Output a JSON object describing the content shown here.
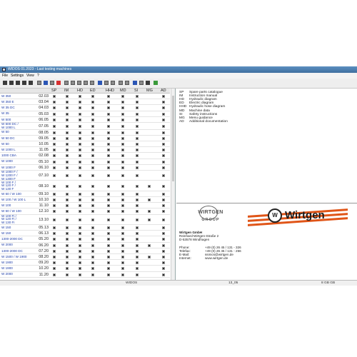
{
  "window": {
    "title": "WIDOS 01.2023 - Last testing machines"
  },
  "menu": [
    "File",
    "Settings",
    "View",
    "?"
  ],
  "grid": {
    "columns": [
      "SP",
      "IM",
      "HD",
      "ED",
      "HHD",
      "MD",
      "SI",
      "MG",
      "AD"
    ],
    "rows": [
      {
        "name": [
          "W 350"
        ],
        "code": "02.03",
        "cells": [
          1,
          1,
          1,
          1,
          1,
          1,
          1,
          0,
          1
        ]
      },
      {
        "name": [
          "W 350 E"
        ],
        "code": "03.04",
        "cells": [
          1,
          1,
          1,
          1,
          1,
          1,
          1,
          0,
          1
        ]
      },
      {
        "name": [
          "W 35 DC"
        ],
        "code": "04.03",
        "cells": [
          1,
          1,
          1,
          1,
          1,
          1,
          1,
          0,
          1
        ]
      },
      {
        "name": [
          "W 35"
        ],
        "code": "05.03",
        "cells": [
          1,
          1,
          1,
          1,
          1,
          1,
          1,
          0,
          1
        ]
      },
      {
        "name": [
          "W 500"
        ],
        "code": "06.05",
        "cells": [
          1,
          1,
          1,
          1,
          1,
          1,
          1,
          0,
          1
        ]
      },
      {
        "name": [
          "W 600 DC /",
          "W 1000 L"
        ],
        "code": "07.05",
        "cells": [
          1,
          1,
          1,
          1,
          1,
          1,
          1,
          0,
          1
        ]
      },
      {
        "name": [
          "W 50"
        ],
        "code": "08.05",
        "cells": [
          1,
          1,
          1,
          1,
          1,
          1,
          1,
          0,
          1
        ]
      },
      {
        "name": [
          "W 50 DC"
        ],
        "code": "09.05",
        "cells": [
          1,
          1,
          1,
          1,
          1,
          1,
          1,
          0,
          1
        ]
      },
      {
        "name": [
          "W 50"
        ],
        "code": "10.05",
        "cells": [
          1,
          1,
          1,
          1,
          1,
          1,
          1,
          0,
          1
        ]
      },
      {
        "name": [
          "W 1000 L"
        ],
        "code": "11.05",
        "cells": [
          1,
          1,
          1,
          1,
          1,
          1,
          1,
          0,
          1
        ]
      },
      {
        "name": [
          "1000 CBA"
        ],
        "code": "02.08",
        "cells": [
          1,
          1,
          1,
          1,
          1,
          1,
          1,
          0,
          1
        ]
      },
      {
        "name": [
          "W 1000"
        ],
        "code": "05.10",
        "cells": [
          1,
          1,
          1,
          1,
          1,
          1,
          1,
          0,
          1
        ]
      },
      {
        "name": [
          "W 1000 F"
        ],
        "code": "06.10",
        "cells": [
          1,
          1,
          1,
          1,
          1,
          1,
          1,
          0,
          1
        ]
      },
      {
        "name": [
          "W 1000 F /",
          "W 1200 F /",
          "W 1300 F"
        ],
        "code": "07.10",
        "cells": [
          1,
          1,
          1,
          1,
          1,
          1,
          1,
          0,
          1
        ]
      },
      {
        "name": [
          "W 100 F /",
          "W 120 F /",
          "W 130 F"
        ],
        "code": "08.10",
        "cells": [
          1,
          1,
          1,
          1,
          1,
          1,
          1,
          1,
          1
        ]
      },
      {
        "name": [
          "W 60 / W 100"
        ],
        "code": "09.10",
        "cells": [
          1,
          1,
          1,
          1,
          1,
          1,
          1,
          0,
          1
        ]
      },
      {
        "name": [
          "W 100 / W 100 L"
        ],
        "code": "10.10",
        "cells": [
          1,
          1,
          1,
          1,
          1,
          1,
          1,
          1,
          1
        ]
      },
      {
        "name": [
          "W 100"
        ],
        "code": "11.10",
        "cells": [
          1,
          1,
          1,
          1,
          1,
          1,
          1,
          0,
          1
        ]
      },
      {
        "name": [
          "W 60 / W 100"
        ],
        "code": "12.10",
        "cells": [
          1,
          1,
          1,
          1,
          1,
          1,
          1,
          1,
          1
        ]
      },
      {
        "name": [
          "W 100 Fi /",
          "W 120 Fi /",
          "W 130 Fi"
        ],
        "code": "13.10",
        "cells": [
          1,
          1,
          1,
          1,
          1,
          1,
          1,
          1,
          1
        ]
      },
      {
        "name": [
          "W 150"
        ],
        "code": "05.13",
        "cells": [
          1,
          1,
          1,
          1,
          1,
          1,
          1,
          0,
          1
        ]
      },
      {
        "name": [
          "W 150"
        ],
        "code": "06.13",
        "cells": [
          1,
          1,
          1,
          1,
          1,
          1,
          1,
          0,
          1
        ]
      },
      {
        "name": [
          "1300-2000 DC"
        ],
        "code": "05.20",
        "cells": [
          1,
          1,
          1,
          1,
          1,
          1,
          1,
          0,
          1
        ]
      },
      {
        "name": [
          "W 2000"
        ],
        "code": "06.20",
        "cells": [
          1,
          1,
          1,
          1,
          1,
          1,
          1,
          1,
          1
        ]
      },
      {
        "name": [
          "1300-2000 DC"
        ],
        "code": "07.20",
        "cells": [
          1,
          1,
          1,
          1,
          1,
          1,
          1,
          0,
          1
        ]
      },
      {
        "name": [
          "W 1500 / W 1900"
        ],
        "code": "08.20",
        "cells": [
          1,
          1,
          1,
          1,
          1,
          1,
          1,
          1,
          1
        ]
      },
      {
        "name": [
          "W 1900"
        ],
        "code": "09.20",
        "cells": [
          1,
          1,
          1,
          1,
          1,
          1,
          1,
          0,
          1
        ]
      },
      {
        "name": [
          "W 1900"
        ],
        "code": "10.20",
        "cells": [
          1,
          1,
          1,
          1,
          1,
          1,
          1,
          0,
          1
        ]
      },
      {
        "name": [
          "W 2000"
        ],
        "code": "11.20",
        "cells": [
          1,
          1,
          1,
          1,
          1,
          1,
          1,
          0,
          1
        ]
      }
    ]
  },
  "legend": [
    {
      "key": "SP",
      "label": "Spare parts catalogue"
    },
    {
      "key": "IM",
      "label": "Instruction manual"
    },
    {
      "key": "HD",
      "label": "Hydraulic diagram"
    },
    {
      "key": "ED",
      "label": "Electric diagram"
    },
    {
      "key": "HHD",
      "label": "Hydraulic hose diagram"
    },
    {
      "key": "MD",
      "label": "Machine data"
    },
    {
      "key": "SI",
      "label": "Safety instructions"
    },
    {
      "key": "MG",
      "label": "Menu guidance"
    },
    {
      "key": "AD",
      "label": "Additional documentation"
    }
  ],
  "logos": {
    "group_line1": "WIRTGEN",
    "group_line2": "GROUP",
    "brand": "Wirtgen",
    "badge_letter": "W"
  },
  "company": {
    "name": "Wirtgen GmbH",
    "street": "Reinhard-Wirtgen-Straße 2",
    "city": "D-53578 Windhagen",
    "contacts": [
      {
        "label": "Phone:",
        "value": "+49 (0) 26 45 / 131 - 326"
      },
      {
        "label": "Telefax:",
        "value": "+49 (0) 26 45 / 131 - 256"
      },
      {
        "label": "E-Mail:",
        "value": "ssmics@wirtgen.de"
      },
      {
        "label": "Internet:",
        "value": "www.wirtgen.de"
      }
    ]
  },
  "status": {
    "left": "WIDOS",
    "mid": "13_05",
    "right": "8 GB  GB"
  }
}
